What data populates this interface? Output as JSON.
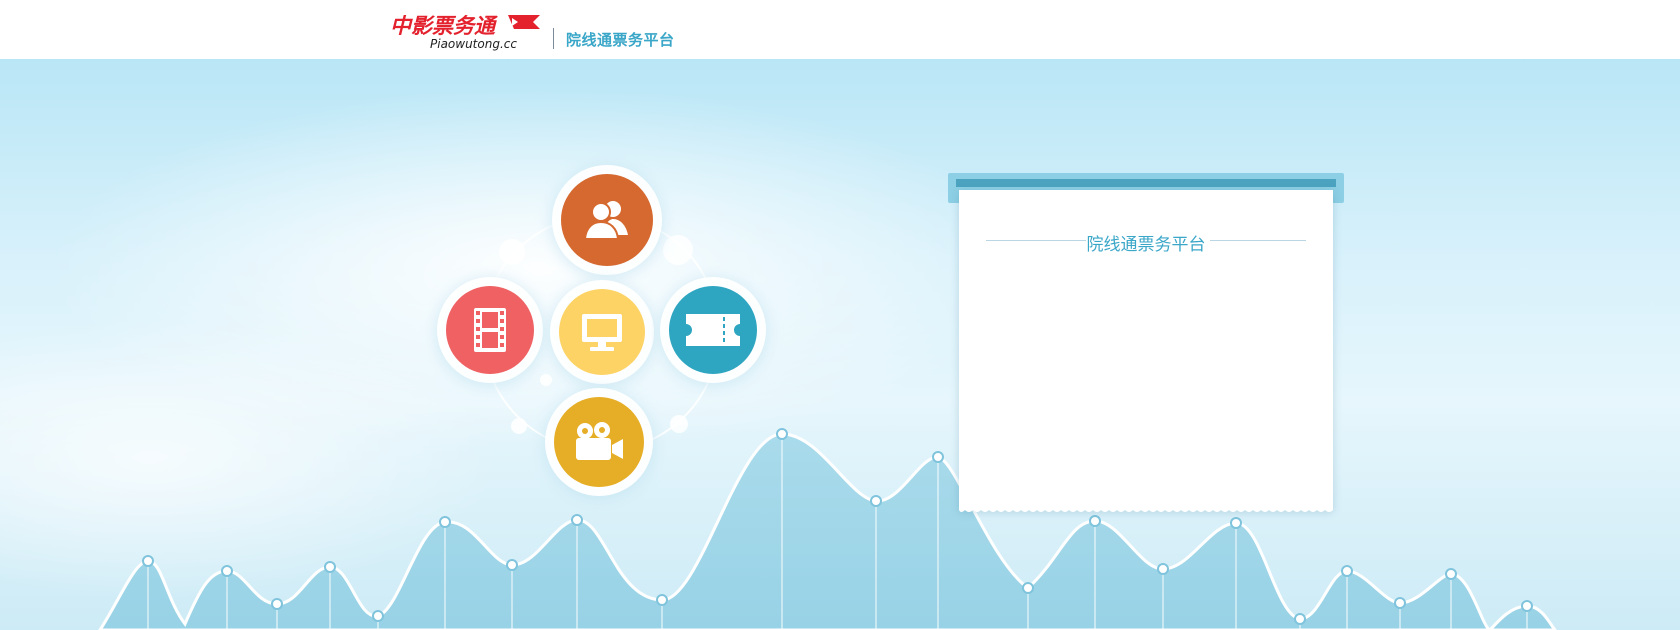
{
  "header": {
    "logo_text": "中影票务通",
    "logo_subtext": "Piaowutong.cc",
    "title": "院线通票务平台"
  },
  "card": {
    "title": "院线通票务平台"
  },
  "icons": [
    {
      "name": "users-icon",
      "color": "#d5692f"
    },
    {
      "name": "film-strip-icon",
      "color": "#ef6163"
    },
    {
      "name": "monitor-icon",
      "color": "#fdd366"
    },
    {
      "name": "ticket-icon",
      "color": "#2ea6c1"
    },
    {
      "name": "video-camera-icon",
      "color": "#e6ae27"
    }
  ],
  "colors": {
    "accent": "#3aa6c8",
    "brand_red": "#e3222e",
    "mountain": "#a3d8ea"
  }
}
